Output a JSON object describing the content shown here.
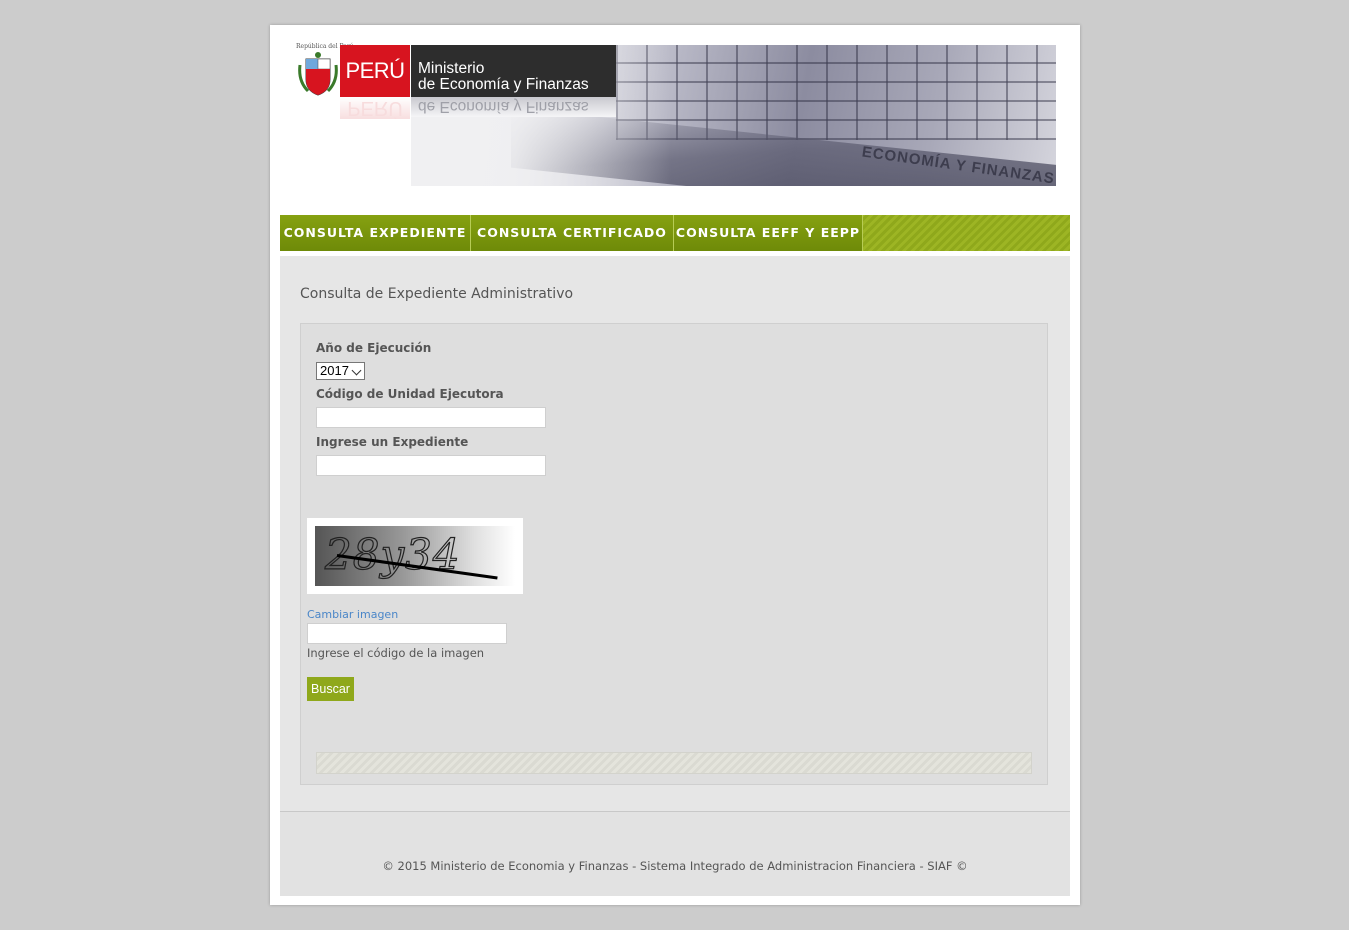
{
  "header": {
    "shield_caption": "República del Perú",
    "peru_label": "PERÚ",
    "ministry_line1": "Ministerio",
    "ministry_line2": "de Economía y Finanzas",
    "building_sign": "ECONOMÍA Y FINANZAS"
  },
  "nav": {
    "tabs": [
      {
        "label": "CONSULTA EXPEDIENTE"
      },
      {
        "label": "CONSULTA CERTIFICADO"
      },
      {
        "label": "CONSULTA EEFF Y EEPP"
      }
    ]
  },
  "main": {
    "title": "Consulta de Expediente Administrativo",
    "form": {
      "year_label": "Año de Ejecución",
      "year_value": "2017",
      "unit_label": "Código de Unidad Ejecutora",
      "unit_value": "",
      "expediente_label": "Ingrese un Expediente",
      "expediente_value": "",
      "captcha_text": "28y34",
      "change_image_label": "Cambiar imagen",
      "captcha_code_value": "",
      "captcha_hint": "Ingrese el código de la imagen",
      "search_button_label": "Buscar"
    }
  },
  "footer": {
    "text": "© 2015 Ministerio de Economia y Finanzas - Sistema Integrado de Administracion Financiera - SIAF ©"
  },
  "colors": {
    "nav_green": "#7c980f",
    "peru_red": "#d7141f",
    "ministry_dark": "#2d2d2d",
    "link_blue": "#4a86c8",
    "button_green": "#8fa81b"
  }
}
